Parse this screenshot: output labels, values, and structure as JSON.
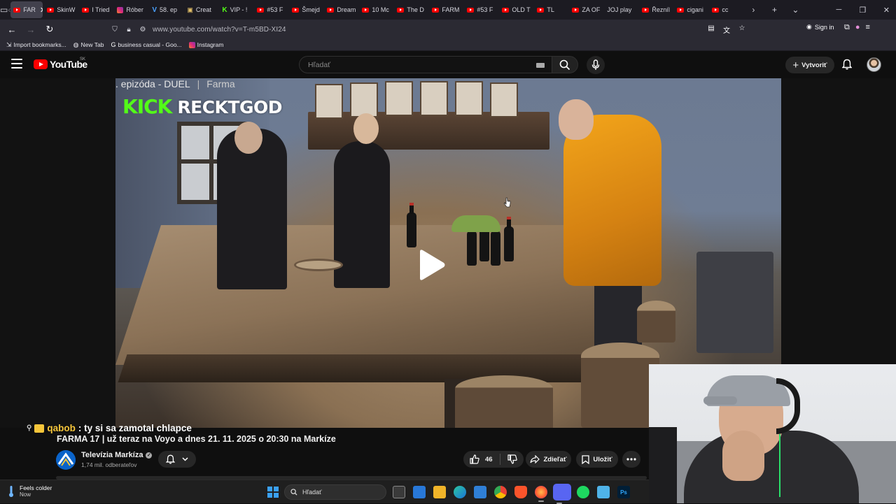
{
  "browser": {
    "tabs": [
      {
        "label": "FAR",
        "icon": "youtube",
        "active": true
      },
      {
        "label": "SkinW",
        "icon": "youtube"
      },
      {
        "label": "I Tried",
        "icon": "youtube"
      },
      {
        "label": "Róber",
        "icon": "instagram"
      },
      {
        "label": "58. ep",
        "icon": "v"
      },
      {
        "label": "Creat",
        "icon": "doc"
      },
      {
        "label": "VIP - !",
        "icon": "kick"
      },
      {
        "label": "#53 F",
        "icon": "youtube"
      },
      {
        "label": "Šmejd",
        "icon": "youtube"
      },
      {
        "label": "Dream",
        "icon": "youtube"
      },
      {
        "label": "10 Mc",
        "icon": "youtube"
      },
      {
        "label": "The D",
        "icon": "youtube"
      },
      {
        "label": "FARM",
        "icon": "youtube"
      },
      {
        "label": "#53 F",
        "icon": "youtube"
      },
      {
        "label": "OLD T",
        "icon": "youtube"
      },
      {
        "label": "TL",
        "icon": "youtube"
      },
      {
        "label": "ZA OF",
        "icon": "youtube"
      },
      {
        "label": "JOJ play",
        "icon": "none"
      },
      {
        "label": "Řezníl",
        "icon": "youtube"
      },
      {
        "label": "cigani",
        "icon": "youtube"
      },
      {
        "label": "cc",
        "icon": "youtube"
      }
    ],
    "url": "www.youtube.com/watch?v=T-m5BD-XI24",
    "sign_in": "Sign in",
    "bookmarks": [
      {
        "label": "Import bookmarks...",
        "icon": "import-icon"
      },
      {
        "label": "New Tab",
        "icon": "globe-icon"
      },
      {
        "label": "business casual - Goo...",
        "icon": "google-icon"
      },
      {
        "label": "Instagram",
        "icon": "instagram-icon"
      }
    ]
  },
  "youtube": {
    "logo_text": "YouTube",
    "region": "SK",
    "search_placeholder": "Hľadať",
    "create_label": "Vytvoriť",
    "video": {
      "overlay_title": ". epizóda - DUEL",
      "overlay_show": "Farma",
      "kick_logo": "KICK",
      "kick_channel": "RECKTGOD"
    },
    "chat": {
      "user": "qabob",
      "message": ": ty si sa zamotal chlapce"
    },
    "title": "FARMA 17 | už teraz na Voyo a dnes 21. 11. 2025 o 20:30 na Markíze",
    "channel": {
      "name": "Televízia Markíza",
      "subscribers": "1,74 mil. odberateľov",
      "verified_mark": "✓"
    },
    "actions": {
      "like_count": "46",
      "share_label": "Zdieľať",
      "save_label": "Uložiť"
    }
  },
  "taskbar": {
    "weather_title": "Feels colder",
    "weather_sub": "Now",
    "search_label": "Hľadať",
    "apps": [
      "task-view",
      "store",
      "file-explorer",
      "edge",
      "photos",
      "chrome",
      "brave",
      "firefox",
      "discord",
      "spotify",
      "notepad",
      "photoshop"
    ],
    "photoshop_label": "Ps"
  },
  "colors": {
    "youtube_red": "#ff0000",
    "kick_green": "#53fc18",
    "chat_user": "#f5c53a",
    "bg": "#0f0f0f"
  }
}
